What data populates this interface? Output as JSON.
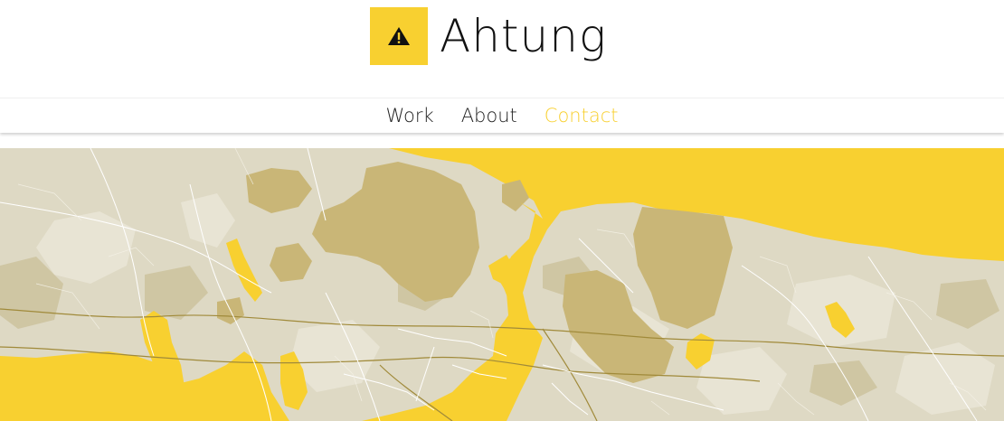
{
  "site": {
    "brand_name": "Ahtung",
    "logo_icon": "warning-icon",
    "logo_glyph": "!"
  },
  "nav": {
    "items": [
      {
        "label": "Work",
        "active": false
      },
      {
        "label": "About",
        "active": false
      },
      {
        "label": "Contact",
        "active": true
      }
    ]
  },
  "map": {
    "description_icon": "city-map",
    "colors": {
      "water": "#f8d030",
      "land": "#ded9c4",
      "land_light": "#e8e4d4",
      "land_dark": "#cfc6a3",
      "forest": "#c9b677",
      "road_major": "#ffffff",
      "road_highway": "#a08a3a"
    }
  },
  "colors": {
    "accent": "#f8d030",
    "text": "#222222",
    "background": "#ffffff"
  }
}
